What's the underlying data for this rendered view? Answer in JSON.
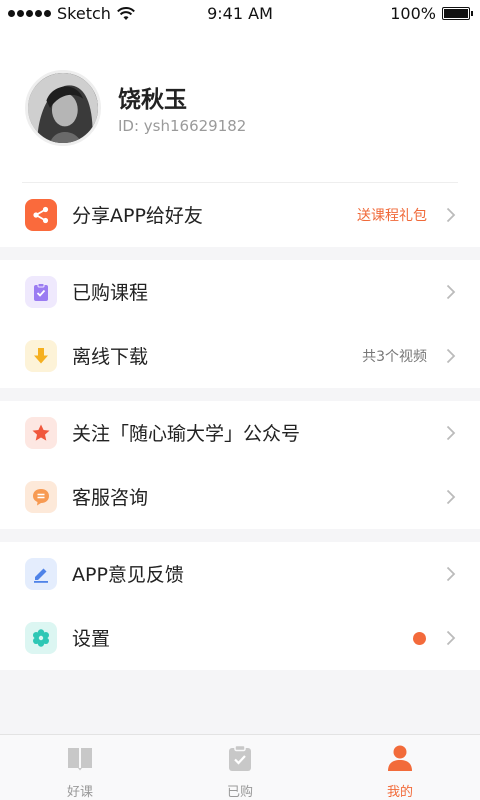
{
  "status_bar": {
    "carrier": "Sketch",
    "time": "9:41 AM",
    "battery": "100%"
  },
  "profile": {
    "name": "饶秋玉",
    "id_text": "ID: ysh16629182"
  },
  "menu": {
    "share": {
      "label": "分享APP给好友",
      "extra": "送课程礼包",
      "icon": "share-icon",
      "color": "#fa6a3c"
    },
    "purchased": {
      "label": "已购课程",
      "icon": "clipboard-check-icon",
      "color": "#9b7cf2"
    },
    "offline": {
      "label": "离线下载",
      "extra": "共3个视频",
      "icon": "download-arrow-icon",
      "color": "#f5b020"
    },
    "follow": {
      "label": "关注「随心瑜大学」公众号",
      "icon": "star-icon",
      "color": "#f0573c"
    },
    "service": {
      "label": "客服咨询",
      "icon": "chat-bubble-icon",
      "color": "#f79a52"
    },
    "feedback": {
      "label": "APP意见反馈",
      "icon": "pencil-icon",
      "color": "#4f83e8"
    },
    "settings": {
      "label": "设置",
      "icon": "gear-icon",
      "color": "#2ec7b5"
    }
  },
  "tab_bar": {
    "tabs": [
      {
        "label": "好课",
        "icon": "book-icon",
        "active": false
      },
      {
        "label": "已购",
        "icon": "clipboard-check-icon",
        "active": false
      },
      {
        "label": "我的",
        "icon": "person-icon",
        "active": true
      }
    ],
    "active_color": "#f26b3a",
    "inactive_color": "#c8c8c8"
  }
}
